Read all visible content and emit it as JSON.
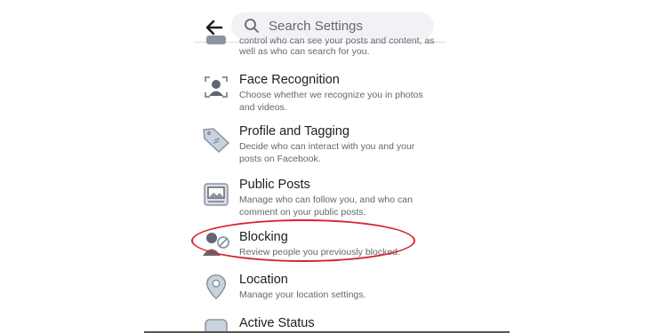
{
  "search": {
    "placeholder": "Search Settings"
  },
  "partial_item": {
    "desc_line1": "control who can see your posts and content, as",
    "desc_line2": "well as who can search for you."
  },
  "items": [
    {
      "title": "Face Recognition",
      "desc": "Choose whether we recognize you in photos and videos.",
      "icon": "face-recognition-icon"
    },
    {
      "title": "Profile and Tagging",
      "desc": "Decide who can interact with you and your posts on Facebook.",
      "icon": "tag-icon"
    },
    {
      "title": "Public Posts",
      "desc": "Manage who can follow you, and who can comment on your public posts.",
      "icon": "public-posts-icon"
    },
    {
      "title": "Blocking",
      "desc": "Review people you previously blocked.",
      "icon": "blocking-icon"
    },
    {
      "title": "Location",
      "desc": "Manage your location settings.",
      "icon": "location-pin-icon"
    },
    {
      "title": "Active Status",
      "desc": "",
      "icon": "active-status-icon"
    }
  ],
  "colors": {
    "highlight_ellipse": "#d9232e",
    "icon_fill": "#8d949e",
    "icon_bg": "#d8dee8"
  }
}
